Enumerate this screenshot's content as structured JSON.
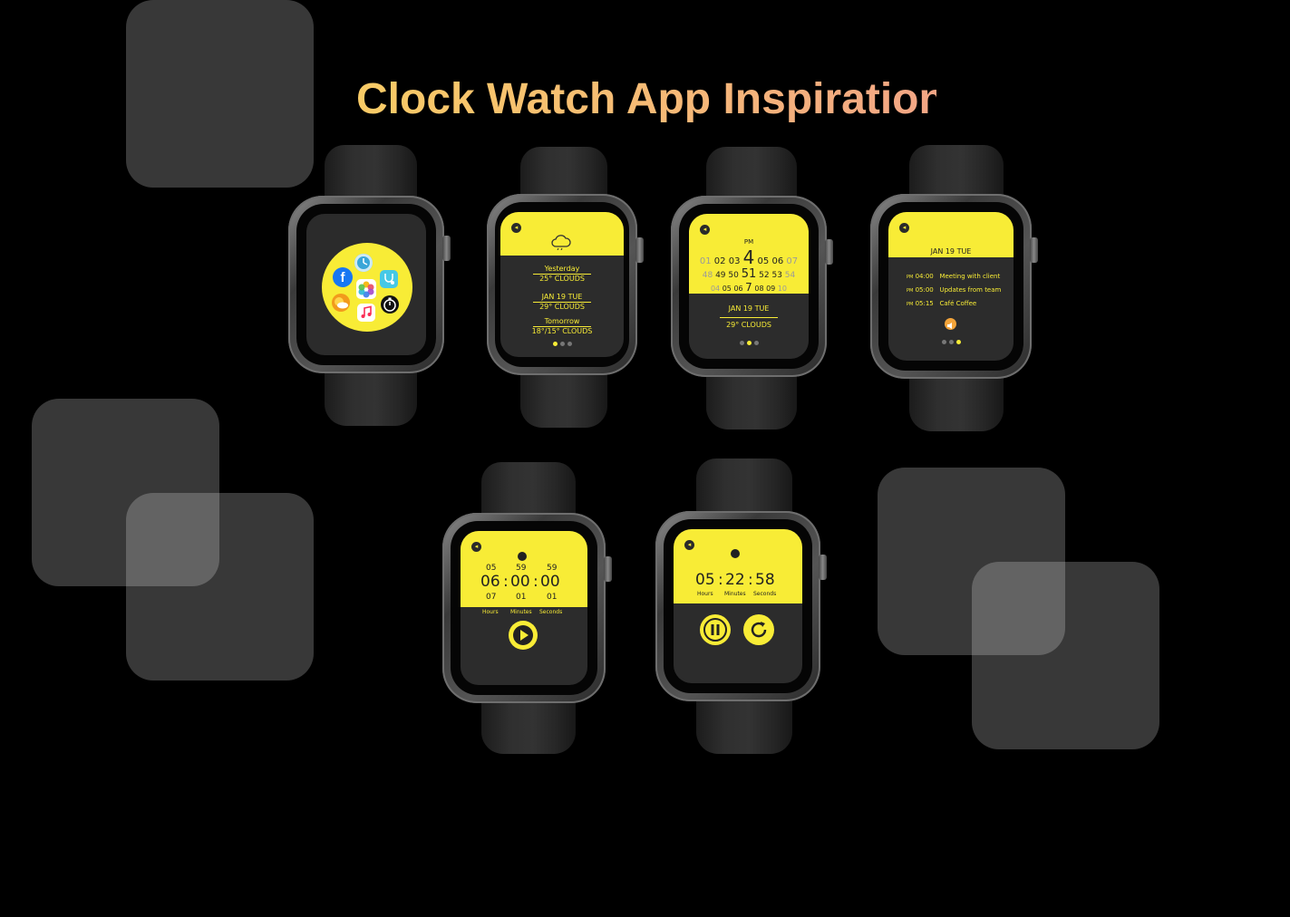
{
  "title": "Clock Watch App Inspiration",
  "colors": {
    "accent": "#f8ec36",
    "screen": "#2c2c2c",
    "background": "#000000"
  },
  "watch1": {
    "apps": [
      "facebook-icon",
      "clock-icon",
      "stethoscope-icon",
      "weather-icon",
      "photos-icon",
      "stopwatch-icon",
      "music-icon"
    ]
  },
  "watch2": {
    "icon": "cloud-icon",
    "entries": [
      {
        "label": "Yesterday",
        "value": "25° CLOUDS"
      },
      {
        "label": "JAN 19 TUE",
        "value": "29° CLOUDS"
      },
      {
        "label": "Tomorrow",
        "value": "18°/15° CLOUDS"
      }
    ]
  },
  "watch3": {
    "ampm": "PM",
    "hours": [
      "01",
      "02",
      "03",
      "4",
      "05",
      "06",
      "07"
    ],
    "minutes": [
      "48",
      "49",
      "50",
      "51",
      "52",
      "53",
      "54"
    ],
    "bottom_row": [
      "04",
      "05",
      "06",
      "7",
      "08",
      "09",
      "10"
    ],
    "date": "JAN 19 TUE",
    "weather": "29° CLOUDS"
  },
  "watch4": {
    "date": "JAN 19 TUE",
    "events": [
      {
        "ampm": "PM",
        "time": "04:00",
        "title": "Meeting with client"
      },
      {
        "ampm": "PM",
        "time": "05:00",
        "title": "Updates from team"
      },
      {
        "ampm": "PM",
        "time": "05:15",
        "title": "Café Coffee"
      }
    ]
  },
  "timer": {
    "above": [
      "05",
      "59",
      "59"
    ],
    "current": [
      "06",
      "00",
      "00"
    ],
    "below": [
      "07",
      "01",
      "01"
    ],
    "labels": [
      "Hours",
      "Minutes",
      "Seconds"
    ],
    "separator": ":"
  },
  "running": {
    "time": [
      "05",
      "22",
      "58"
    ],
    "labels": [
      "Hours",
      "Minutes",
      "Seconds"
    ],
    "separator": ":"
  }
}
